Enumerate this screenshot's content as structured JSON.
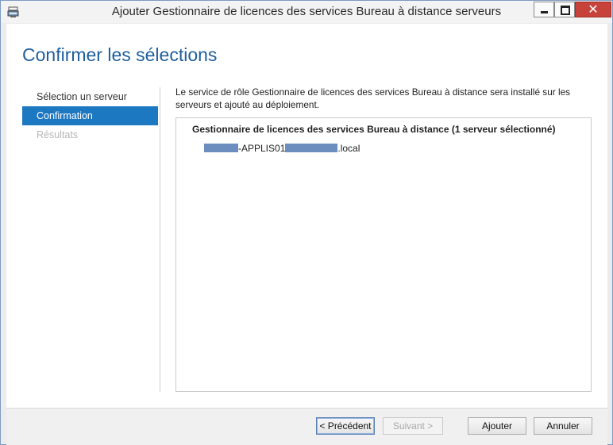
{
  "window": {
    "title": "Ajouter Gestionnaire de licences des services Bureau à distance serveurs",
    "controls": {
      "close_glyph": "✕"
    }
  },
  "page": {
    "title": "Confirmer les sélections"
  },
  "nav": {
    "items": [
      {
        "label": "Sélection un serveur",
        "state": "completed"
      },
      {
        "label": "Confirmation",
        "state": "selected"
      },
      {
        "label": "Résultats",
        "state": "disabled"
      }
    ]
  },
  "main": {
    "description": "Le service de rôle Gestionnaire de licences des services Bureau à distance sera installé sur les serveurs et ajouté au déploiement.",
    "group_heading": "Gestionnaire de licences des services Bureau à distance  (1 serveur sélectionné)",
    "server": {
      "middle": "-APPLIS01",
      "suffix": ".local"
    }
  },
  "footer": {
    "previous": "< Précédent",
    "next": "Suivant >",
    "add": "Ajouter",
    "cancel": "Annuler"
  },
  "colors": {
    "accent": "#1d78c2",
    "title": "#1f5f9b",
    "close": "#c7423a",
    "redaction": "#6b8ebe"
  },
  "icons": [
    "server-manager-icon",
    "minimize-icon",
    "maximize-icon",
    "close-icon"
  ]
}
